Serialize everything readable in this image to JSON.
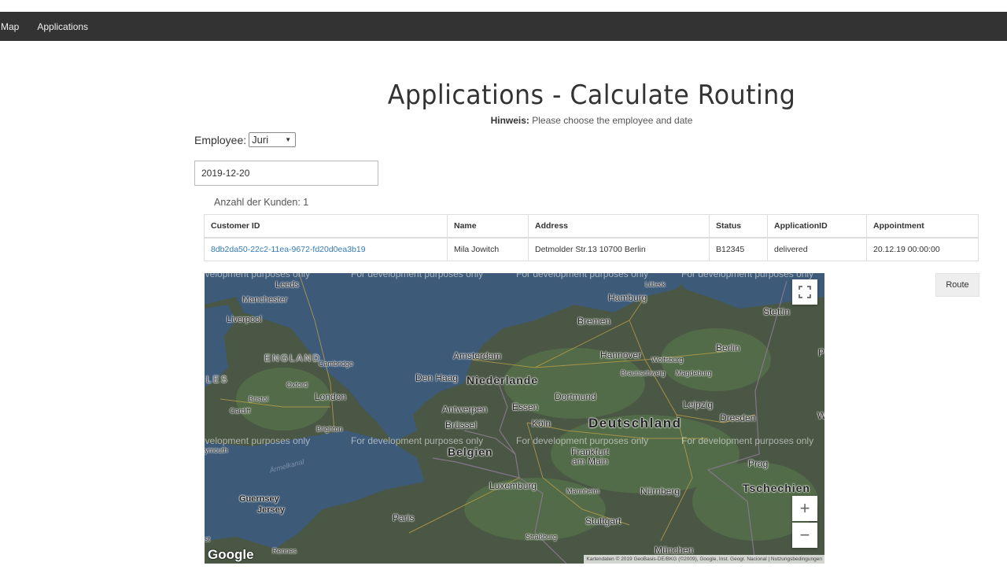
{
  "nav": {
    "items": [
      "Map",
      "Applications"
    ]
  },
  "page": {
    "title": "Applications - Calculate Routing",
    "hint_label": "Hinweis:",
    "hint_text": "Please choose the employee and date"
  },
  "form": {
    "employee_label": "Employee:",
    "employee_value": "Juri",
    "date_value": "2019-12-20"
  },
  "count_label": "Anzahl der Kunden: 1",
  "table": {
    "headers": [
      "Customer ID",
      "Name",
      "Address",
      "Status",
      "ApplicationID",
      "Appointment"
    ],
    "rows": [
      [
        "8db2da50-22c2-11ea-9672-fd20d0ea3b19",
        "Mila Jowitch",
        "Detmolder Str.13 10700 Berlin",
        "B12345",
        "delivered",
        "20.12.19 00:00:00"
      ]
    ]
  },
  "route_button": "Route",
  "map": {
    "dev_text": "For development purposes only",
    "dev_text_cut1": "evelopment purposes only",
    "dev_text_cut2": "For development purposes only",
    "labels": {
      "leeds": "Leeds",
      "manchester": "Manchester",
      "liverpool": "Liverpool",
      "england": "ENGLAND",
      "cambridge": "Cambridge",
      "les": "LES",
      "oxford": "Oxford",
      "bristol": "Bristol",
      "london": "London",
      "cardiff": "Cardiff",
      "brighton": "Brighton",
      "ymouth": "ymouth",
      "amelkanal": "Ärmelkanal",
      "guernsey": "Guernsey",
      "jersey": "Jersey",
      "rennes": "Rennes",
      "st": "st",
      "paris": "Paris",
      "hamburg": "Hamburg",
      "lubeck": "Lübeck",
      "stettin": "Stettin",
      "bremen": "Bremen",
      "amsterdam": "Amsterdam",
      "den_haag": "Den Haag",
      "niederlande": "Niederlande",
      "hannover": "Hannover",
      "wolfsburg": "Wolfsburg",
      "berlin": "Berlin",
      "braunschweig": "Braunschweig",
      "magdeburg": "Magdeburg",
      "dortmund": "Dortmund",
      "essen": "Essen",
      "antwerpen": "Antwerpen",
      "brussel": "Brüssel",
      "koln": "Köln",
      "deutschland": "Deutschland",
      "leipzig": "Leipzig",
      "dresden": "Dresden",
      "belgien": "Belgien",
      "frankfurt": "Frankfurt\nam Main",
      "prag": "Prag",
      "luxemburg": "Luxemburg",
      "mannheim": "Mannheim",
      "nurnberg": "Nürnberg",
      "tschechien": "Tschechien",
      "stuttgart": "Stuttgart",
      "strassburg": "Straßburg",
      "munchen": "München",
      "p": "P",
      "w": "W"
    },
    "zoom_in": "+",
    "zoom_out": "−",
    "google": "Google",
    "attribution": "Kartendaten © 2019 GeoBasis-DE/BKG (©2009), Google, Inst. Geogr. Nacional | Nutzungsbedingungen"
  }
}
